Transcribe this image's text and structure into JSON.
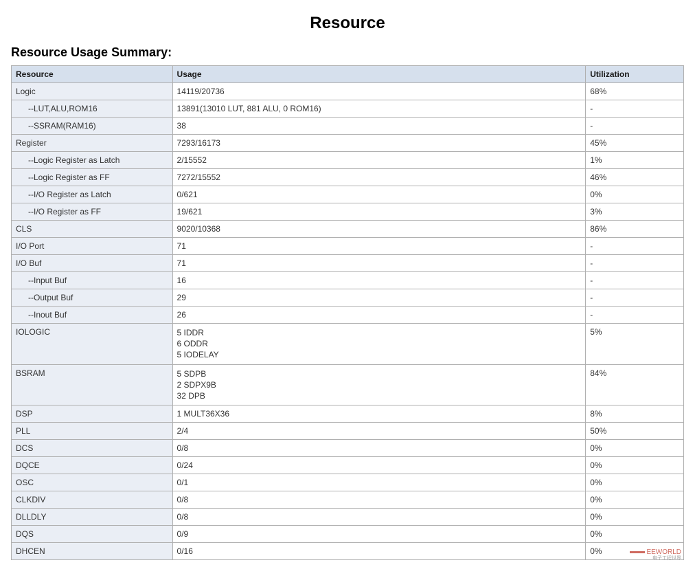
{
  "title": "Resource",
  "subtitle": "Resource Usage Summary:",
  "headers": {
    "resource": "Resource",
    "usage": "Usage",
    "utilization": "Utilization"
  },
  "rows": [
    {
      "resource": "Logic",
      "usage": "14119/20736",
      "utilization": "68%",
      "indent": false
    },
    {
      "resource": "--LUT,ALU,ROM16",
      "usage": "13891(13010 LUT, 881 ALU, 0 ROM16)",
      "utilization": "-",
      "indent": true
    },
    {
      "resource": "--SSRAM(RAM16)",
      "usage": "38",
      "utilization": "-",
      "indent": true
    },
    {
      "resource": "Register",
      "usage": "7293/16173",
      "utilization": "45%",
      "indent": false
    },
    {
      "resource": "--Logic Register as Latch",
      "usage": "2/15552",
      "utilization": "1%",
      "indent": true
    },
    {
      "resource": "--Logic Register as FF",
      "usage": "7272/15552",
      "utilization": "46%",
      "indent": true
    },
    {
      "resource": "--I/O Register as Latch",
      "usage": "0/621",
      "utilization": "0%",
      "indent": true
    },
    {
      "resource": "--I/O Register as FF",
      "usage": "19/621",
      "utilization": "3%",
      "indent": true
    },
    {
      "resource": "CLS",
      "usage": "9020/10368",
      "utilization": "86%",
      "indent": false
    },
    {
      "resource": "I/O Port",
      "usage": "71",
      "utilization": "-",
      "indent": false
    },
    {
      "resource": "I/O Buf",
      "usage": "71",
      "utilization": "-",
      "indent": false
    },
    {
      "resource": "--Input Buf",
      "usage": "16",
      "utilization": "-",
      "indent": true
    },
    {
      "resource": "--Output Buf",
      "usage": "29",
      "utilization": "-",
      "indent": true
    },
    {
      "resource": "--Inout Buf",
      "usage": "26",
      "utilization": "-",
      "indent": true
    },
    {
      "resource": "IOLOGIC",
      "usage": "5 IDDR\n6 ODDR\n5 IODELAY",
      "utilization": "5%",
      "indent": false,
      "multi": true
    },
    {
      "resource": "BSRAM",
      "usage": "5 SDPB\n2 SDPX9B\n32 DPB",
      "utilization": "84%",
      "indent": false,
      "multi": true
    },
    {
      "resource": "DSP",
      "usage": "1 MULT36X36",
      "utilization": "8%",
      "indent": false
    },
    {
      "resource": "PLL",
      "usage": "2/4",
      "utilization": "50%",
      "indent": false
    },
    {
      "resource": "DCS",
      "usage": "0/8",
      "utilization": "0%",
      "indent": false
    },
    {
      "resource": "DQCE",
      "usage": "0/24",
      "utilization": "0%",
      "indent": false
    },
    {
      "resource": "OSC",
      "usage": "0/1",
      "utilization": "0%",
      "indent": false
    },
    {
      "resource": "CLKDIV",
      "usage": "0/8",
      "utilization": "0%",
      "indent": false
    },
    {
      "resource": "DLLDLY",
      "usage": "0/8",
      "utilization": "0%",
      "indent": false
    },
    {
      "resource": "DQS",
      "usage": "0/9",
      "utilization": "0%",
      "indent": false
    },
    {
      "resource": "DHCEN",
      "usage": "0/16",
      "utilization": "0%",
      "indent": false
    }
  ],
  "watermark": {
    "main": "EEWORLD",
    "sub": "电子工程世界"
  }
}
